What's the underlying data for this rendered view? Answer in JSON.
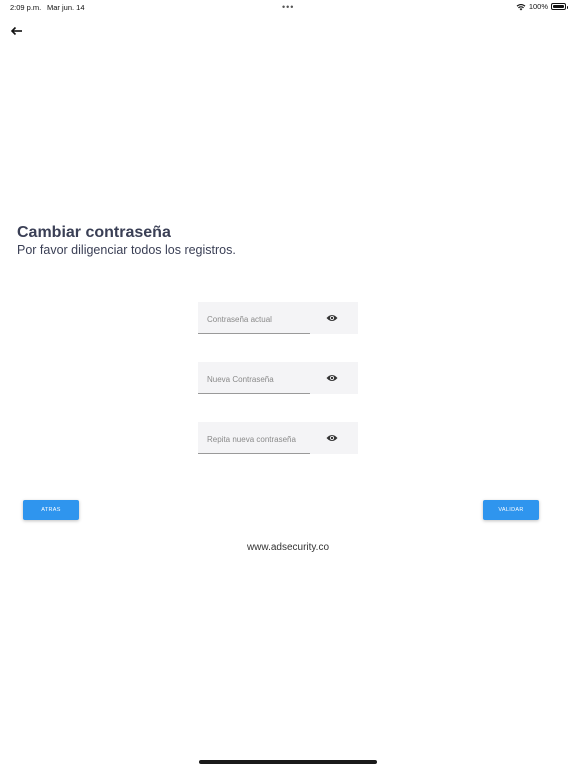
{
  "status_bar": {
    "time": "2:09 p.m.",
    "date": "Mar jun. 14",
    "dots": "•••",
    "battery": "100%"
  },
  "header": {
    "title": "Cambiar contraseña",
    "subtitle": "Por favor diligenciar todos los registros."
  },
  "form": {
    "current_password": {
      "placeholder": "Contraseña actual",
      "value": ""
    },
    "new_password": {
      "placeholder": "Nueva Contraseña",
      "value": ""
    },
    "repeat_password": {
      "placeholder": "Repita nueva contraseña",
      "value": ""
    }
  },
  "actions": {
    "back_label": "ATRAS",
    "validate_label": "VALIDAR"
  },
  "footer": {
    "website": "www.adsecurity.co"
  },
  "colors": {
    "accent": "#2f95ee",
    "title": "#3a3f55",
    "field_bg": "#f4f4f6"
  }
}
